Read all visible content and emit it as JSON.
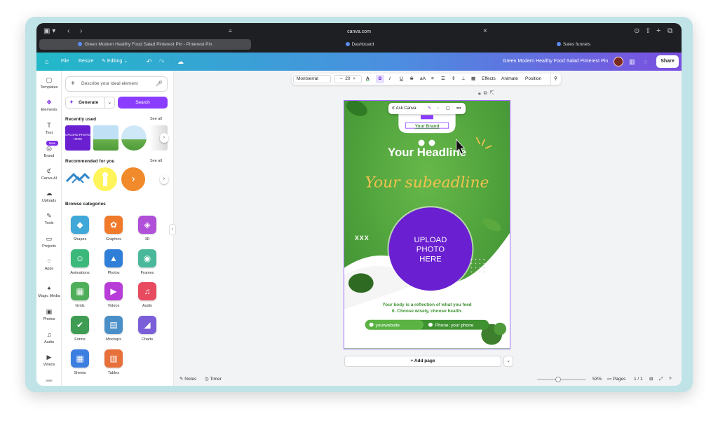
{
  "browser": {
    "url": "canva.com",
    "tabs": [
      {
        "label": "Green Modern Healthy Food Salad Pinterest Pin - Pinterest Pin",
        "active": true
      },
      {
        "label": "Dashboard",
        "active": false
      },
      {
        "label": "Sales funnels",
        "active": false
      }
    ]
  },
  "header": {
    "file": "File",
    "resize": "Resize",
    "editing": "Editing",
    "doc_title": "Green Modern Healthy Food Salad Pinterest Pin",
    "share": "Share"
  },
  "rail": {
    "items": [
      {
        "label": "Templates",
        "icon": "templates-icon",
        "glyph": "▢"
      },
      {
        "label": "Elements",
        "icon": "elements-icon",
        "glyph": "❖"
      },
      {
        "label": "Text",
        "icon": "text-icon",
        "glyph": "T"
      },
      {
        "label": "Brand",
        "icon": "brand-icon",
        "glyph": "◎"
      },
      {
        "label": "Canva AI",
        "icon": "canva-ai-icon",
        "glyph": "ℭ"
      },
      {
        "label": "Uploads",
        "icon": "uploads-icon",
        "glyph": "☁"
      },
      {
        "label": "Tools",
        "icon": "tools-icon",
        "glyph": "✎"
      },
      {
        "label": "Projects",
        "icon": "projects-icon",
        "glyph": "▭"
      },
      {
        "label": "Apps",
        "icon": "apps-icon",
        "glyph": "⁘"
      },
      {
        "label": "Magic Media",
        "icon": "magic-media-icon",
        "glyph": "✦"
      },
      {
        "label": "Photos",
        "icon": "photos-icon",
        "glyph": "▣"
      },
      {
        "label": "Audio",
        "icon": "audio-icon",
        "glyph": "♫"
      },
      {
        "label": "Videos",
        "icon": "videos-icon",
        "glyph": "▶"
      }
    ],
    "new_badge": "New"
  },
  "panel": {
    "search_placeholder": "Describe your ideal element",
    "generate": "Generate",
    "search": "Search",
    "recently_used": "Recently used",
    "recommended": "Recommended for you",
    "see_all": "See all",
    "upload_thumb": "UPLOAD PHOTO HERE",
    "browse": "Browse categories",
    "categories": [
      {
        "label": "Shapes",
        "color": "#3fa8d8",
        "glyph": "◆"
      },
      {
        "label": "Graphics",
        "color": "#f07a2a",
        "glyph": "✿"
      },
      {
        "label": "3D",
        "color": "#b04fd8",
        "glyph": "◈"
      },
      {
        "label": "Animations",
        "color": "#3cb87a",
        "glyph": "☺"
      },
      {
        "label": "Photos",
        "color": "#2f7fd8",
        "glyph": "▲"
      },
      {
        "label": "Frames",
        "color": "#49b89a",
        "glyph": "◉"
      },
      {
        "label": "Grids",
        "color": "#4fae5a",
        "glyph": "▦"
      },
      {
        "label": "Videos",
        "color": "#b83cd8",
        "glyph": "▶"
      },
      {
        "label": "Audio",
        "color": "#e84a5f",
        "glyph": "♫"
      },
      {
        "label": "Forms",
        "color": "#3e9d52",
        "glyph": "✔"
      },
      {
        "label": "Mockups",
        "color": "#4a8fc8",
        "glyph": "▤"
      },
      {
        "label": "Charts",
        "color": "#7a5fd8",
        "glyph": "◢"
      },
      {
        "label": "Sheets",
        "color": "#3d7fe0",
        "glyph": "▦"
      },
      {
        "label": "Tables",
        "color": "#e8703a",
        "glyph": "▥"
      }
    ]
  },
  "toolbar": {
    "font": "Montserrat",
    "size": "20",
    "minus": "–",
    "plus": "+",
    "bold": "B",
    "italic": "I",
    "underline": "U",
    "strike": "S",
    "case": "aA",
    "effects": "Effects",
    "animate": "Animate",
    "position": "Position"
  },
  "ctxbar": {
    "ask": "Ask Canva"
  },
  "design": {
    "brand": "Your Brand",
    "headline": "Your Headline",
    "subheadline": "Your subeadline",
    "xxx": "XXX",
    "upload": [
      "UPLOAD",
      "PHOTO",
      "HERE"
    ],
    "body1": "Your body is a reflection of what you feed",
    "body2": "it. Choose wisely, choose health.",
    "website": "yourwebsite",
    "phone": "Phone: your phone"
  },
  "canvas": {
    "add_page": "+ Add page"
  },
  "bottom": {
    "notes": "Notes",
    "timer": "Timer",
    "zoom": "53%",
    "pages": "Pages",
    "page_count": "1 / 1"
  },
  "colors": {
    "accent": "#8b3dff",
    "green": "#4da23c",
    "purple_circle": "#6a1fd0",
    "headline_yellow": "#f2c14e"
  }
}
